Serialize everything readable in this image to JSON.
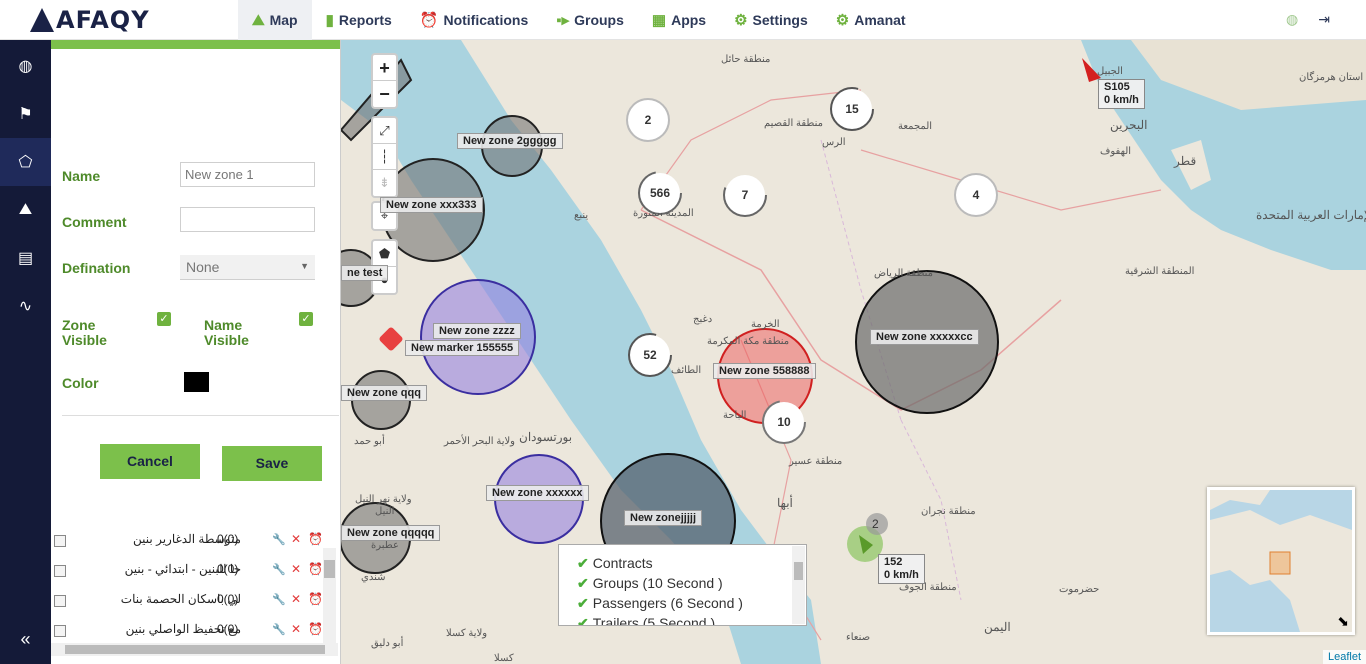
{
  "app": {
    "logo_text": "AFAQY"
  },
  "nav": {
    "items": [
      {
        "label": "Map",
        "icon": "map-icon"
      },
      {
        "label": "Reports",
        "icon": "bar-chart-icon"
      },
      {
        "label": "Notifications",
        "icon": "alarm-clock-icon"
      },
      {
        "label": "Groups",
        "icon": "groups-icon"
      },
      {
        "label": "Apps",
        "icon": "grid-icon"
      },
      {
        "label": "Settings",
        "icon": "gear-icon"
      },
      {
        "label": "Amanat",
        "icon": "gear-icon"
      }
    ],
    "active": "Map"
  },
  "sidebar": {
    "items": [
      "globe-icon",
      "flag-icon",
      "zones-icon",
      "routes-icon",
      "clipboard-icon",
      "links-icon"
    ],
    "active_index": 2
  },
  "form": {
    "name_label": "Name",
    "name_value": "New zone 1",
    "comment_label": "Comment",
    "comment_value": "",
    "definition_label": "Defination",
    "definition_value": "None",
    "zone_visible_label_1": "Zone",
    "zone_visible_label_2": "Visible",
    "name_visible_label_1": "Name",
    "name_visible_label_2": "Visible",
    "zone_visible_checked": true,
    "name_visible_checked": true,
    "color_label": "Color",
    "color_value": "#000000",
    "cancel_label": "Cancel",
    "save_label": "Save"
  },
  "zone_list": [
    {
      "name": "متوسطة الدغارير بنين",
      "count": "0(0)"
    },
    {
      "name": "حا للبنين - ابتدائي - بنين",
      "count": "0(0)"
    },
    {
      "name": "لي باسكان الحصمة بنات",
      "count": "0(0)"
    },
    {
      "name": "مع تحفيظ الواصلي بنين",
      "count": "0(0)"
    }
  ],
  "map": {
    "zone_labels": [
      "New zone 2ggggg",
      "New zone xxx333",
      "ne test",
      "New zone zzzz",
      "New marker 155555",
      "New zone qqq",
      "New zone 558888",
      "New zone xxxxxcc",
      "New zone xxxxxx",
      "New zone qqqqq",
      "New zonejjjjj"
    ],
    "clusters": [
      "2",
      "566",
      "7",
      "15",
      "4",
      "52",
      "10",
      "2"
    ],
    "vehicles": [
      {
        "name": "S105",
        "speed": "0 km/h"
      },
      {
        "name": "152",
        "speed": "0 km/h"
      }
    ],
    "places": [
      "المدينة المنورة",
      "ينبع",
      "الطائف",
      "الرس",
      "الهفوف",
      "قطر",
      "البحرين",
      "الإمارات العربية المتحدة",
      "أبها",
      "بورتسودان",
      "صنعاء",
      "اليمن",
      "حضرموت",
      "منطقة الجوف",
      "منطقة نجران",
      "منطقة عسير",
      "المنطقة الشرقية",
      "منطقة الرياض",
      "منطقة القصيم",
      "منطقة حائل",
      "المجمعة",
      "الخرمة",
      "منطقة مكة المكرمة",
      "الباحة",
      "الجبيل",
      "استان هرمزگان",
      "أبو حمد",
      "ولاية البحر الأحمر",
      "شندي",
      "عطبرة",
      "كسلا",
      "ولاية كسلا",
      "أبو دليق",
      "دغبج",
      "النيل",
      "ولاية نهر النيل"
    ],
    "zoom_in": "+",
    "zoom_out": "−",
    "attribution": "Leaflet"
  },
  "layers": [
    {
      "label": "Contracts",
      "checked": true
    },
    {
      "label": "Groups (10 Second )",
      "checked": true
    },
    {
      "label": "Passengers (6 Second )",
      "checked": true
    },
    {
      "label": "Trailers (5 Second )",
      "checked": true
    }
  ],
  "colors": {
    "brand_navy": "#141a38",
    "accent_green": "#7cc04b",
    "sea": "#aad3df",
    "zone_gray": "#6b6b6b",
    "zone_purple": "#8f7ae0",
    "zone_red": "#ee5a5a"
  }
}
